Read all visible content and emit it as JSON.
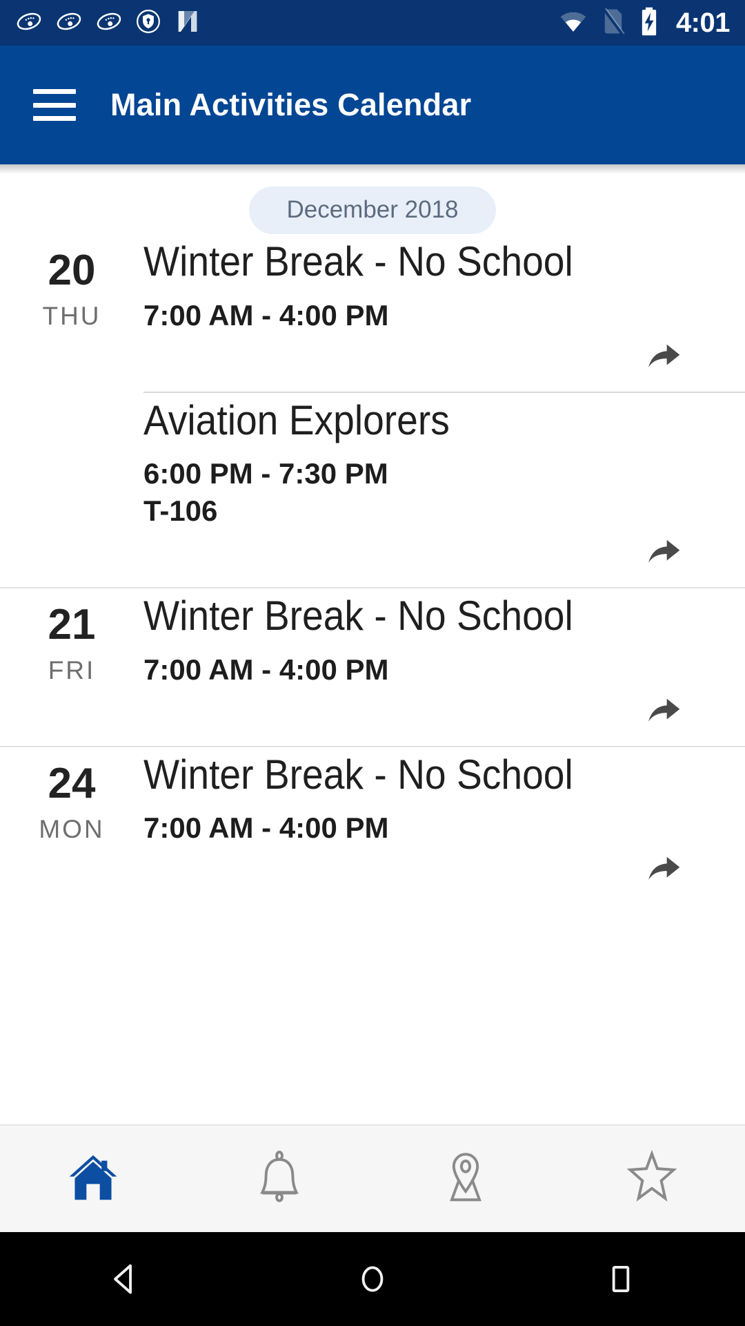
{
  "status_bar": {
    "time": "4:01",
    "left_icons": [
      {
        "name": "app-orbit-icon-1"
      },
      {
        "name": "app-orbit-icon-2"
      },
      {
        "name": "app-orbit-icon-3"
      },
      {
        "name": "shield-key-icon"
      },
      {
        "name": "nextdoor-n-icon"
      }
    ],
    "right_icons": [
      {
        "name": "wifi-icon"
      },
      {
        "name": "no-sim-icon"
      },
      {
        "name": "battery-charging-icon"
      }
    ]
  },
  "app_bar": {
    "menu_label": "menu",
    "title": "Main Activities Calendar"
  },
  "calendar": {
    "month_label": "December 2018",
    "groups": [
      {
        "day_number": "20",
        "day_of_week": "THU",
        "events": [
          {
            "title": "Winter Break - No School",
            "time": "7:00 AM - 4:00 PM",
            "location": "",
            "share_label": "share"
          },
          {
            "title": "Aviation Explorers",
            "time": "6:00 PM - 7:30 PM",
            "location": "T-106",
            "share_label": "share"
          }
        ]
      },
      {
        "day_number": "21",
        "day_of_week": "FRI",
        "events": [
          {
            "title": "Winter Break - No School",
            "time": "7:00 AM - 4:00 PM",
            "location": "",
            "share_label": "share"
          }
        ]
      },
      {
        "day_number": "24",
        "day_of_week": "MON",
        "events": [
          {
            "title": "Winter Break - No School",
            "time": "7:00 AM - 4:00 PM",
            "location": "",
            "share_label": "share"
          }
        ]
      }
    ]
  },
  "bottom_tabs": [
    {
      "name": "home-icon",
      "label": "Home",
      "active": true
    },
    {
      "name": "bell-icon",
      "label": "Notifications",
      "active": false
    },
    {
      "name": "map-pin-icon",
      "label": "Map",
      "active": false
    },
    {
      "name": "star-icon",
      "label": "Favorites",
      "active": false
    }
  ],
  "android_nav": [
    {
      "name": "back-icon",
      "label": "Back"
    },
    {
      "name": "home-circle-icon",
      "label": "Home"
    },
    {
      "name": "recents-icon",
      "label": "Recents"
    }
  ],
  "colors": {
    "status_bar_bg": "#0a3572",
    "app_bar_bg": "#034694",
    "accent": "#034694",
    "chip_bg": "#e8eff9",
    "chip_text": "#5d6b7f",
    "tabbar_bg": "#f6f6f6",
    "nav_bg": "#000000"
  }
}
